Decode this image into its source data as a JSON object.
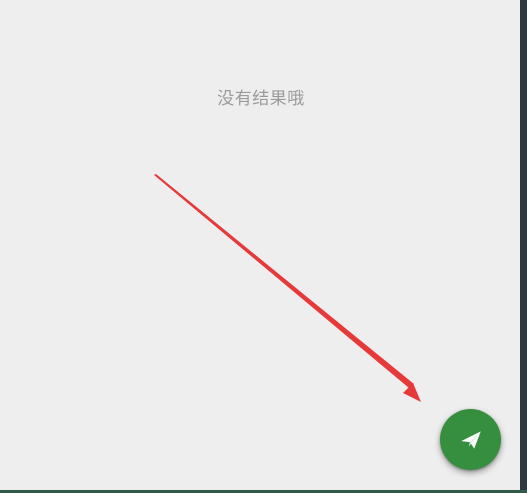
{
  "empty_state": {
    "message": "没有结果哦"
  },
  "fab": {
    "icon": "send-icon",
    "color": "#358f3f"
  },
  "annotation": {
    "type": "arrow",
    "color": "#e63a3a"
  }
}
